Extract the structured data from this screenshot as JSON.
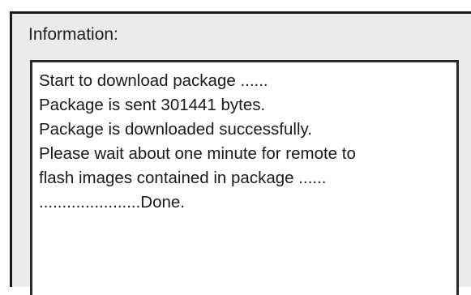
{
  "info_panel": {
    "label": "Information:",
    "lines": [
      "Start to download package ......",
      "Package is sent 301441 bytes.",
      "Package is downloaded successfully.",
      "Please wait about one minute for remote to",
      "flash images contained in package ......",
      "......................Done."
    ]
  },
  "colors": {
    "panel_background": "#ebebeb",
    "text": "#1a1a1a",
    "textbox_background": "#ffffff",
    "border": "#1a1a1a"
  }
}
